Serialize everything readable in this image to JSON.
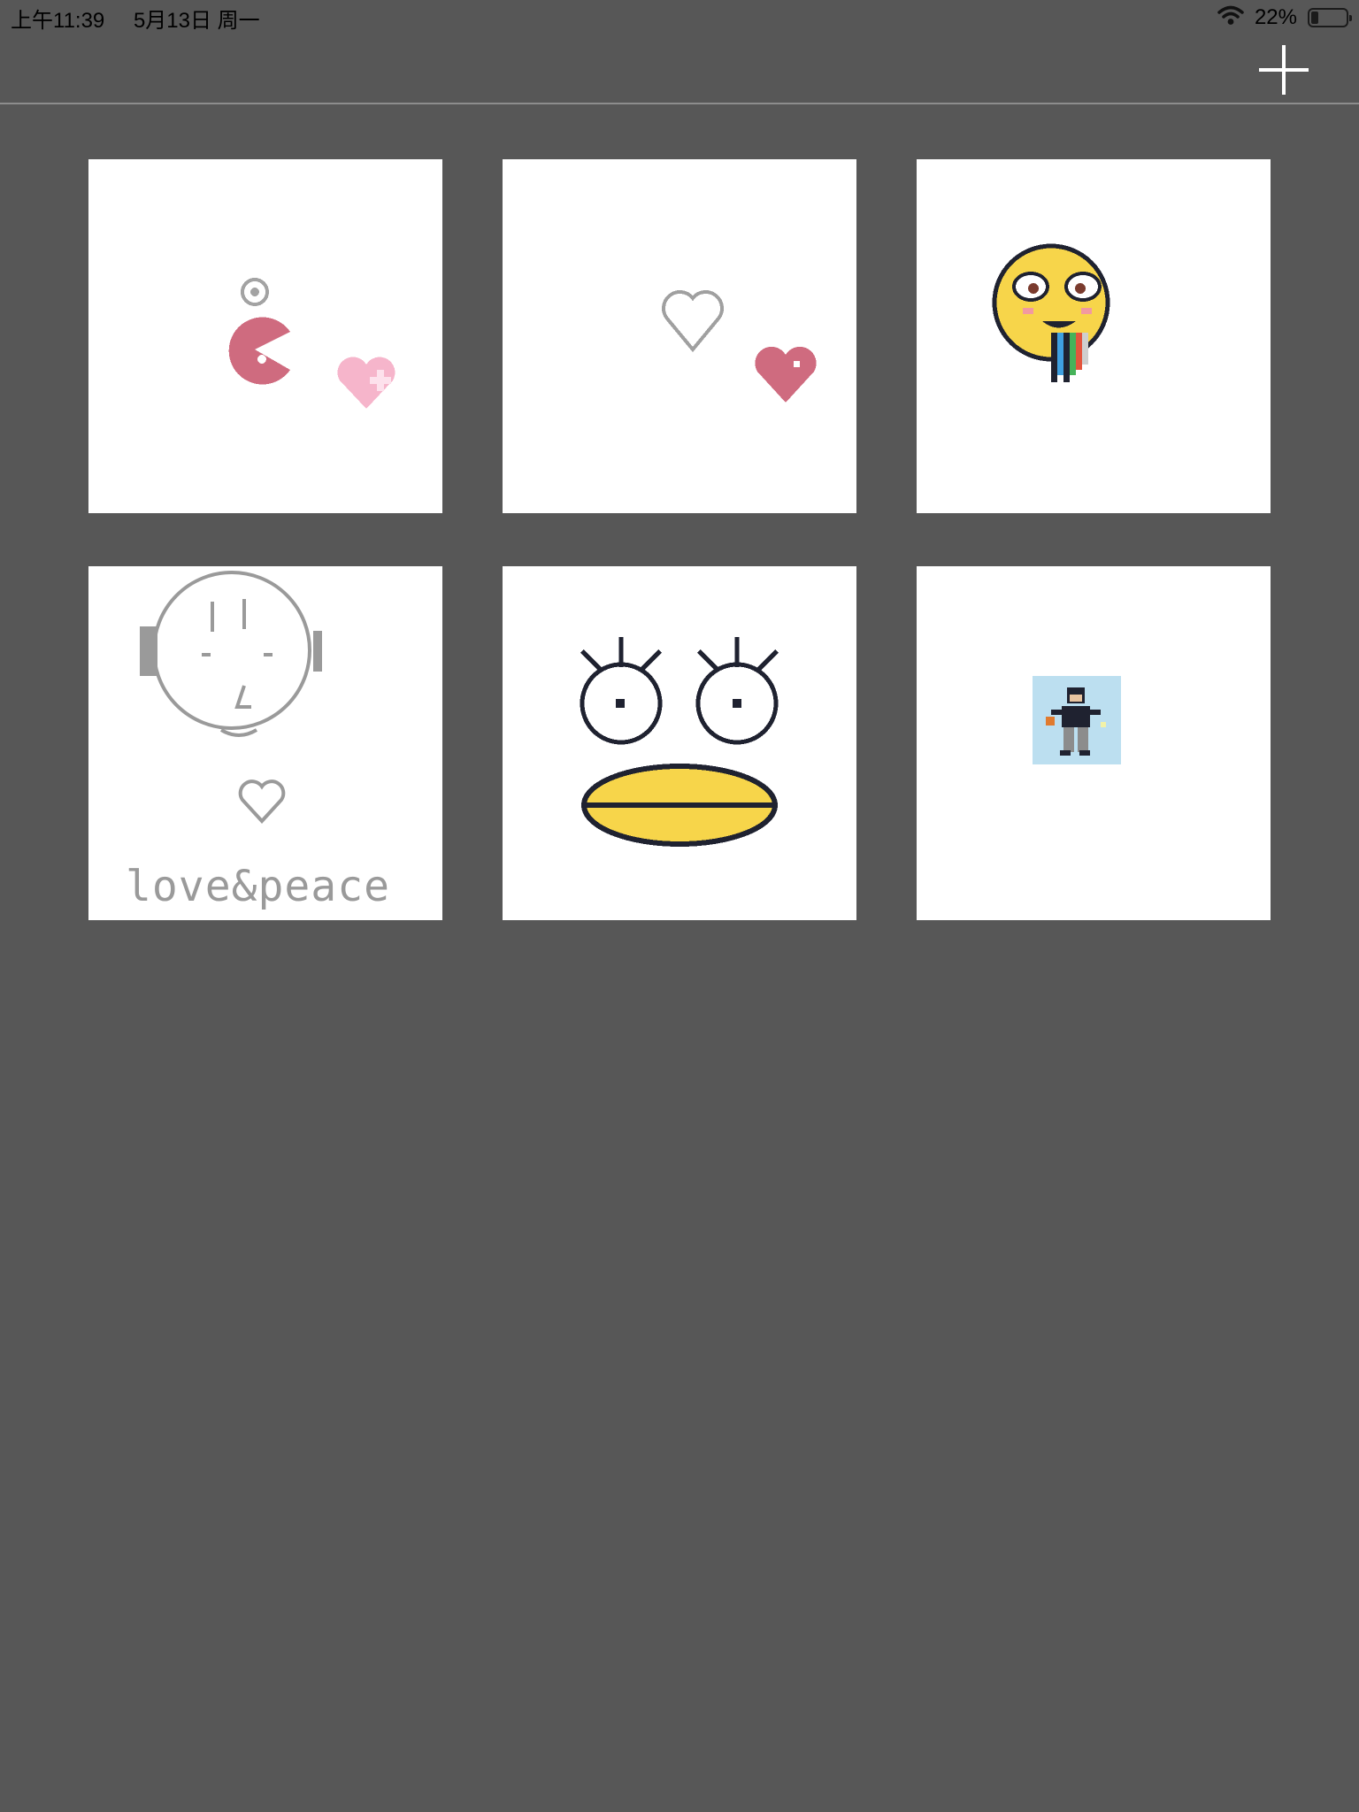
{
  "status_bar": {
    "time": "上午11:39",
    "date": "5月13日 周一",
    "battery_percent": "22%",
    "battery_level": 0.22,
    "icons": [
      "wifi-icon",
      "battery-icon"
    ]
  },
  "toolbar": {
    "add_icon": "plus-icon"
  },
  "gallery": {
    "drawings": [
      {
        "name": "drawing-pacman-heart"
      },
      {
        "name": "drawing-two-hearts"
      },
      {
        "name": "drawing-rainbow-smiley"
      },
      {
        "name": "drawing-love-peace",
        "caption": "love&peace"
      },
      {
        "name": "drawing-duck-face"
      },
      {
        "name": "drawing-pixel-person"
      }
    ]
  },
  "colors": {
    "background": "#575757",
    "tile": "#ffffff",
    "pink": "#cf6b7f",
    "light_pink": "#f6b5cb",
    "yellow": "#f7d54a",
    "dark": "#1f2230",
    "gray": "#9a9a9a",
    "sky": "#bcdff0"
  }
}
